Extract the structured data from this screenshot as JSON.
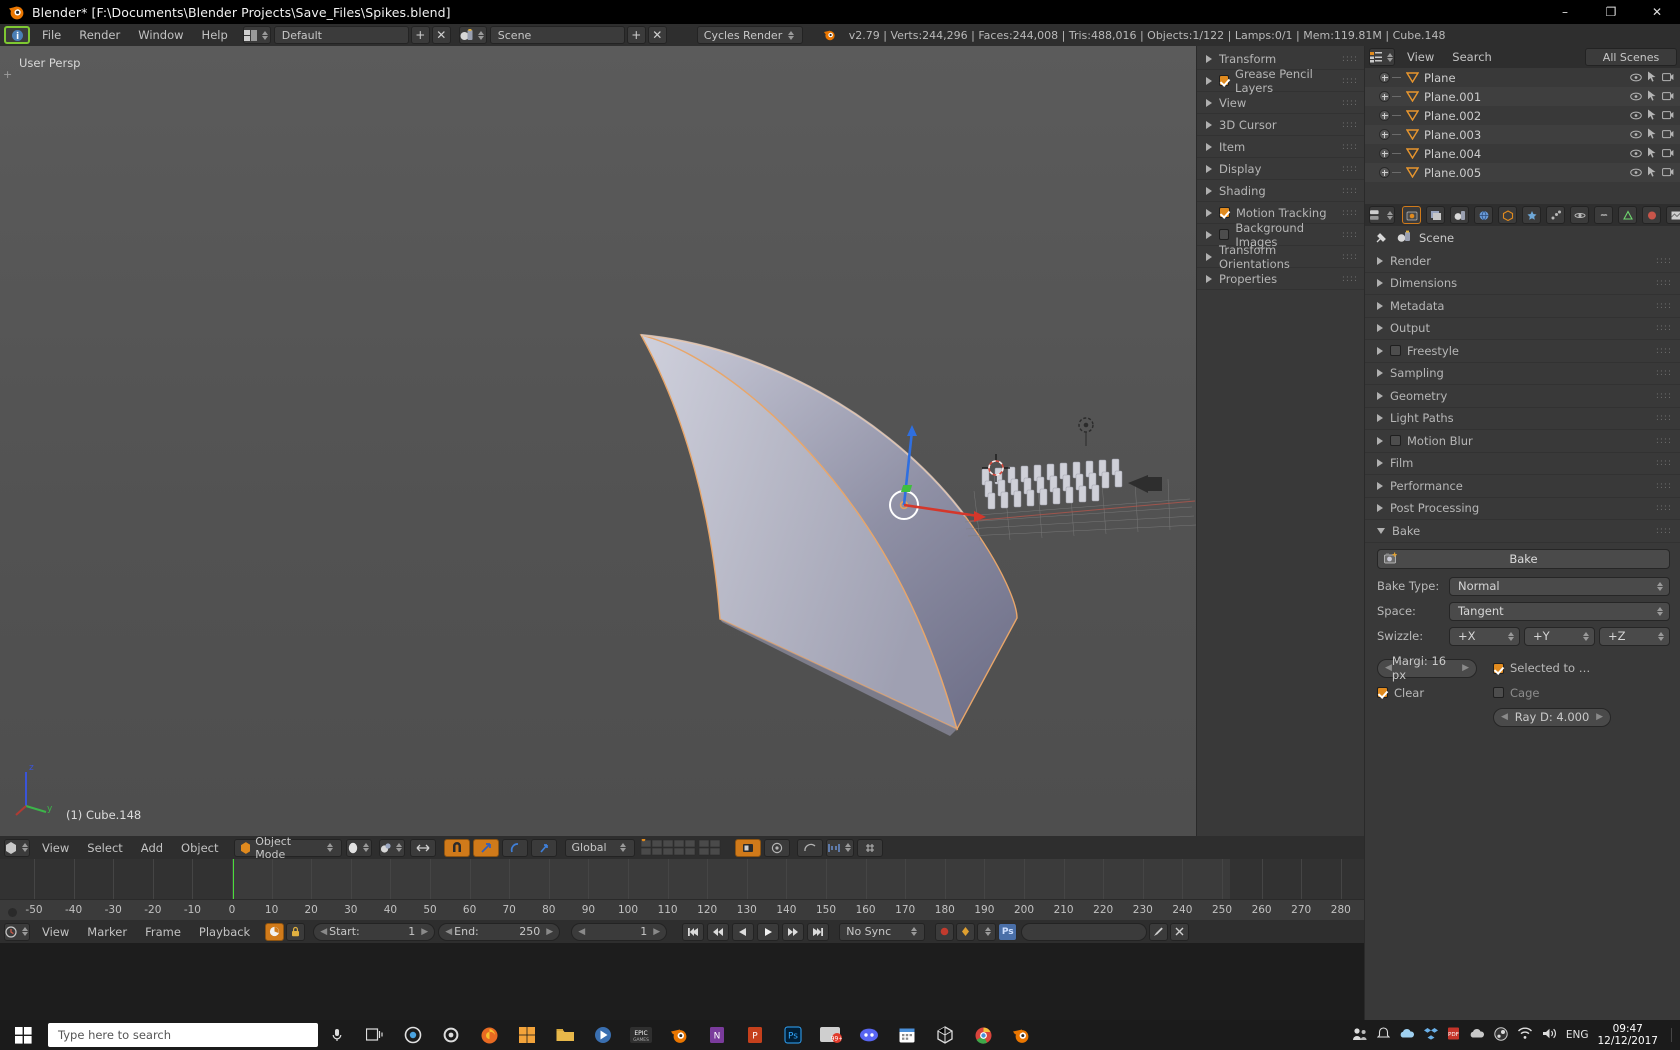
{
  "window": {
    "title": "Blender* [F:\\Documents\\Blender Projects\\Save_Files\\Spikes.blend]",
    "minimize": "–",
    "maximize": "❐",
    "close": "✕",
    "app_icon": "blender-logo-icon"
  },
  "topbar": {
    "menus": [
      "File",
      "Render",
      "Window",
      "Help"
    ],
    "screen_layout": "Default",
    "add_label": "+",
    "remove_label": "✕",
    "scene_name": "Scene",
    "scene_add": "+",
    "scene_remove": "✕",
    "engine": "Cycles Render",
    "stats": "v2.79 | Verts:244,296 | Faces:244,008 | Tris:488,016 | Objects:1/122 | Lamps:0/1 | Mem:119.81M | Cube.148"
  },
  "viewport": {
    "view_label": "User Persp",
    "plus_marker": "+",
    "active_object": "(1) Cube.148",
    "axis_gizmo": {
      "z": "z",
      "y": "y",
      "x": "x"
    }
  },
  "viewport_header": {
    "menus": [
      "View",
      "Select",
      "Add",
      "Object"
    ],
    "mode": "Object Mode",
    "transform_orientation": "Global",
    "editor_icon": "3d-view-editor-icon",
    "shading_icon": "viewport-shading-icon",
    "snap_icon": "snap-magnet-icon",
    "pivot_icon": "pivot-point-icon",
    "manipulator_translate": "translate-manipulator-icon",
    "manipulator_rotate": "rotate-manipulator-icon",
    "manipulator_scale": "scale-manipulator-icon",
    "layers_label": "scene-layers",
    "proportional_icon": "proportional-edit-icon",
    "render_icon": "render-preview-icon"
  },
  "timeline": {
    "ticks": [
      "-50",
      "-40",
      "-30",
      "-20",
      "-10",
      "0",
      "10",
      "20",
      "30",
      "40",
      "50",
      "60",
      "70",
      "80",
      "90",
      "100",
      "110",
      "120",
      "130",
      "140",
      "150",
      "160",
      "170",
      "180",
      "190",
      "200",
      "210",
      "220",
      "230",
      "240",
      "250",
      "260",
      "270",
      "280"
    ],
    "current_frame_marker": 0,
    "menus": [
      "View",
      "Marker",
      "Frame",
      "Playback"
    ],
    "start_label": "Start:",
    "start_value": "1",
    "end_label": "End:",
    "end_value": "250",
    "current_value": "1",
    "sync_mode": "No Sync",
    "jump_start_icon": "jump-to-start-icon",
    "prev_key_icon": "previous-keyframe-icon",
    "play_rev_icon": "play-reverse-icon",
    "play_icon": "play-icon",
    "next_key_icon": "next-keyframe-icon",
    "jump_end_icon": "jump-to-end-icon",
    "auto_key_icon": "auto-keyframe-icon",
    "lock_icon": "lock-icon",
    "record_icon": "record-icon",
    "keying_set_icon": "keying-set-icon",
    "ps_icon": "ps-layer-icon",
    "channel_value": "",
    "pencil_icon": "grease-pencil-icon",
    "x_icon": "remove-icon"
  },
  "npanel": {
    "items": [
      {
        "label": "Transform",
        "checkbox": null
      },
      {
        "label": "Grease Pencil Layers",
        "checkbox": "on"
      },
      {
        "label": "View",
        "checkbox": null
      },
      {
        "label": "3D Cursor",
        "checkbox": null
      },
      {
        "label": "Item",
        "checkbox": null
      },
      {
        "label": "Display",
        "checkbox": null
      },
      {
        "label": "Shading",
        "checkbox": null
      },
      {
        "label": "Motion Tracking",
        "checkbox": "on"
      },
      {
        "label": "Background Images",
        "checkbox": "off"
      },
      {
        "label": "Transform Orientations",
        "checkbox": null
      },
      {
        "label": "Properties",
        "checkbox": null
      }
    ]
  },
  "outliner": {
    "editor_icon": "outliner-editor-icon",
    "menus": [
      "View",
      "Search"
    ],
    "display_mode": "All Scenes",
    "rows": [
      {
        "name": "Plane"
      },
      {
        "name": "Plane.001"
      },
      {
        "name": "Plane.002"
      },
      {
        "name": "Plane.003"
      },
      {
        "name": "Plane.004"
      },
      {
        "name": "Plane.005"
      }
    ],
    "row_icons": [
      "eye-icon",
      "cursor-select-icon",
      "camera-render-icon"
    ]
  },
  "properties": {
    "editor_icon": "properties-editor-icon",
    "tabs": [
      "render-tab-icon",
      "render-layers-tab-icon",
      "scene-tab-icon",
      "world-tab-icon",
      "object-tab-icon",
      "modifier-tab-icon",
      "particles-tab-icon",
      "physics-tab-icon",
      "constraints-tab-icon",
      "data-tab-icon",
      "material-tab-icon",
      "texture-tab-icon"
    ],
    "breadcrumb_pin": "pin-icon",
    "breadcrumb_icon": "scene-icon",
    "breadcrumb": "Scene",
    "panels": [
      {
        "label": "Render",
        "checkbox": null,
        "open": false
      },
      {
        "label": "Dimensions",
        "checkbox": null,
        "open": false
      },
      {
        "label": "Metadata",
        "checkbox": null,
        "open": false
      },
      {
        "label": "Output",
        "checkbox": null,
        "open": false
      },
      {
        "label": "Freestyle",
        "checkbox": "off",
        "open": false
      },
      {
        "label": "Sampling",
        "checkbox": null,
        "open": false
      },
      {
        "label": "Geometry",
        "checkbox": null,
        "open": false
      },
      {
        "label": "Light Paths",
        "checkbox": null,
        "open": false
      },
      {
        "label": "Motion Blur",
        "checkbox": "off",
        "open": false
      },
      {
        "label": "Film",
        "checkbox": null,
        "open": false
      },
      {
        "label": "Performance",
        "checkbox": null,
        "open": false
      },
      {
        "label": "Post Processing",
        "checkbox": null,
        "open": false
      },
      {
        "label": "Bake",
        "checkbox": null,
        "open": true
      }
    ],
    "bake": {
      "button_label": "Bake",
      "button_icon": "bake-render-icon",
      "bake_type_label": "Bake Type:",
      "bake_type_value": "Normal",
      "space_label": "Space:",
      "space_value": "Tangent",
      "swizzle_label": "Swizzle:",
      "swizzle_x": "+X",
      "swizzle_y": "+Y",
      "swizzle_z": "+Z",
      "margin_label": "Margi: 16 px",
      "selected_to_label": "Selected to …",
      "selected_to_checked": "on",
      "clear_label": "Clear",
      "clear_checked": "on",
      "cage_label": "Cage",
      "cage_checked": "off",
      "ray_distance_label": "Ray D: 4.000"
    }
  },
  "taskbar": {
    "start_icon": "windows-start-icon",
    "search_placeholder": "Type here to search",
    "mic_icon": "microphone-icon",
    "task_view_icon": "task-view-icon",
    "apps": [
      "cortana-circle-icon",
      "settings-gear-icon",
      "firefox-icon",
      "store-icon",
      "file-explorer-icon",
      "media-icon",
      "epic-games-icon",
      "blender-app-icon",
      "onenote-icon",
      "powerpoint-icon",
      "photoshop-icon",
      "unknown-99-icon",
      "discord-icon",
      "calendar-icon",
      "blender-2-icon",
      "chrome-icon",
      "blender-3-icon"
    ],
    "tray": [
      "people-icon",
      "onedrive-icon",
      "dropbox-icon",
      "pdf-icon",
      "cloud-icon",
      "steam-icon",
      "wifi-icon",
      "volume-icon"
    ],
    "language": "ENG",
    "time": "09:47",
    "date": "12/12/2017",
    "notification_icon": "notifications-icon"
  }
}
